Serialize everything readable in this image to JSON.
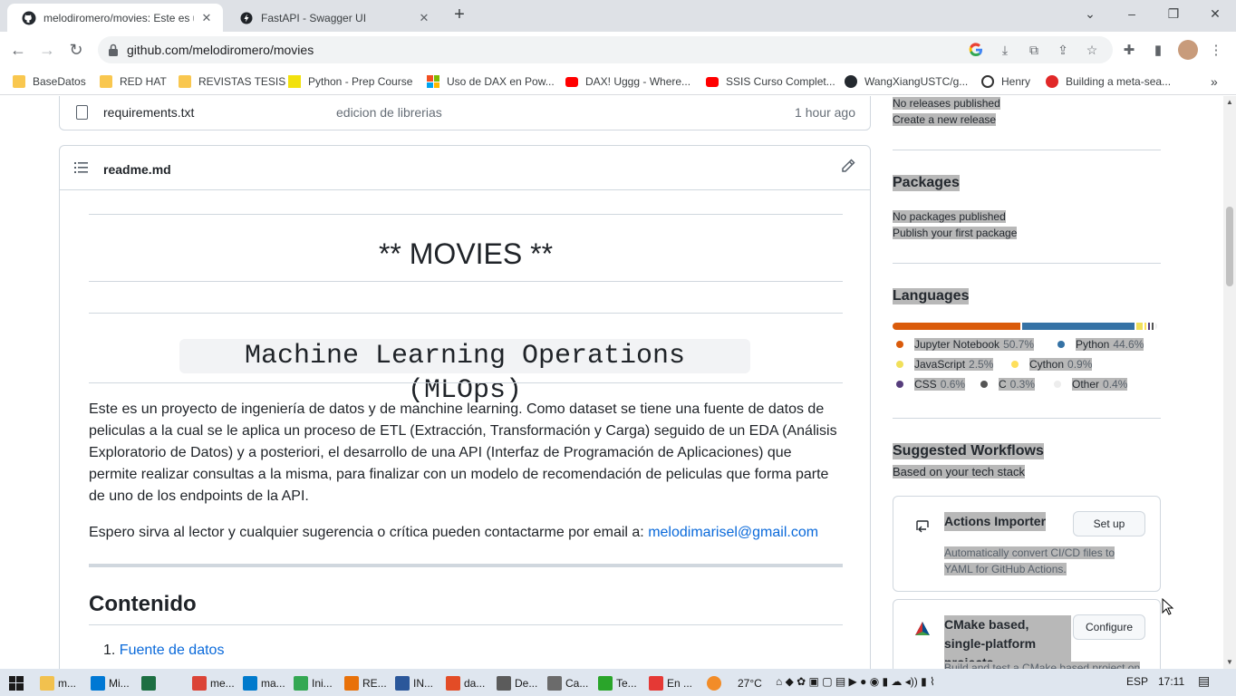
{
  "browser": {
    "tabs": [
      {
        "title": "melodiromero/movies: Este es un",
        "favicon": "github-icon",
        "active": true
      },
      {
        "title": "FastAPI - Swagger UI",
        "favicon": "fastapi-icon",
        "active": false
      }
    ],
    "new_tab": "+",
    "url": "github.com/melodiromero/movies",
    "window_controls": {
      "collapse": "⌄",
      "minimize": "–",
      "restore": "❐",
      "close": "✕"
    }
  },
  "bookmarks": [
    {
      "label": "BaseDatos",
      "icon": "folder"
    },
    {
      "label": "RED HAT",
      "icon": "folder"
    },
    {
      "label": "REVISTAS TESIS",
      "icon": "folder"
    },
    {
      "label": "Python - Prep Course",
      "icon": "python-course"
    },
    {
      "label": "Uso de DAX en Pow...",
      "icon": "microsoft"
    },
    {
      "label": "DAX! Uggg - Where...",
      "icon": "youtube"
    },
    {
      "label": "SSIS Curso Complet...",
      "icon": "youtube"
    },
    {
      "label": "WangXiangUSTC/g...",
      "icon": "github"
    },
    {
      "label": "Henry",
      "icon": "henry"
    },
    {
      "label": "Building a meta-sea...",
      "icon": "scribd"
    }
  ],
  "file_row": {
    "name": "requirements.txt",
    "message": "edicion de librerias",
    "time": "1 hour ago"
  },
  "readme": {
    "filename": "readme.md",
    "h1_movies": "** MOVIES **",
    "h1_mlops": "Machine Learning Operations (MLOps)",
    "intro": "Este es un proyecto de ingeniería de datos y de manchine learning. Como dataset se tiene una fuente de datos de peliculas a la cual se le aplica un proceso de ETL (Extracción, Transformación y Carga) seguido de un EDA (Análisis Exploratorio de Datos) y a posteriori, el desarrollo de una API (Interfaz de Programación de Aplicaciones) que permite realizar consultas a la misma, para finalizar con un modelo de recomendación de peliculas que forma parte de uno de los endpoints de la API.",
    "contact_text": "Espero sirva al lector y cualquier sugerencia o crítica pueden contactarme por email a: ",
    "contact_email": "melodimarisel@gmail.com",
    "contents_heading": "Contenido",
    "contents_items": [
      "Fuente de datos"
    ]
  },
  "sidebar": {
    "releases_none": "No releases published",
    "releases_create": "Create a new release",
    "packages_heading": "Packages",
    "packages_none": "No packages published",
    "packages_publish": "Publish your first package",
    "languages_heading": "Languages",
    "languages": [
      {
        "name": "Jupyter Notebook",
        "pct": "50.7%",
        "percent": 50.7,
        "color": "#DA5B0B"
      },
      {
        "name": "Python",
        "pct": "44.6%",
        "percent": 44.6,
        "color": "#3572A5"
      },
      {
        "name": "JavaScript",
        "pct": "2.5%",
        "percent": 2.5,
        "color": "#f1e05a"
      },
      {
        "name": "Cython",
        "pct": "0.9%",
        "percent": 0.9,
        "color": "#fedf5b"
      },
      {
        "name": "CSS",
        "pct": "0.6%",
        "percent": 0.6,
        "color": "#563d7c"
      },
      {
        "name": "C",
        "pct": "0.3%",
        "percent": 0.3,
        "color": "#555555"
      },
      {
        "name": "Other",
        "pct": "0.4%",
        "percent": 0.4,
        "color": "#ededed"
      }
    ],
    "workflows_heading": "Suggested Workflows",
    "workflows_sub": "Based on your tech stack",
    "workflows": [
      {
        "title": "Actions Importer",
        "button": "Set up",
        "desc": "Automatically convert CI/CD files to YAML for GitHub Actions."
      },
      {
        "title": "CMake based, single-platform projects",
        "button": "Configure",
        "desc": "Build and test a CMake based project on"
      }
    ]
  },
  "taskbar": {
    "items": [
      {
        "label": "m...",
        "color": "#f2c14e"
      },
      {
        "label": "Mi...",
        "color": "#0078d4"
      },
      {
        "label": "",
        "color": "#1d6f42"
      },
      {
        "label": "me...",
        "color": "#db4437"
      },
      {
        "label": "ma...",
        "color": "#007acc"
      },
      {
        "label": "Ini...",
        "color": "#34a853"
      },
      {
        "label": "RE...",
        "color": "#e8710a"
      },
      {
        "label": "IN...",
        "color": "#2b579a"
      },
      {
        "label": "da...",
        "color": "#e34c26"
      },
      {
        "label": "De...",
        "color": "#5b5b5b"
      },
      {
        "label": "Ca...",
        "color": "#6b6b6b"
      },
      {
        "label": "Te...",
        "color": "#2aa52a"
      },
      {
        "label": "En ...",
        "color": "#e53935"
      }
    ],
    "temperature": "27°C",
    "language": "ESP",
    "time": "17:11"
  }
}
